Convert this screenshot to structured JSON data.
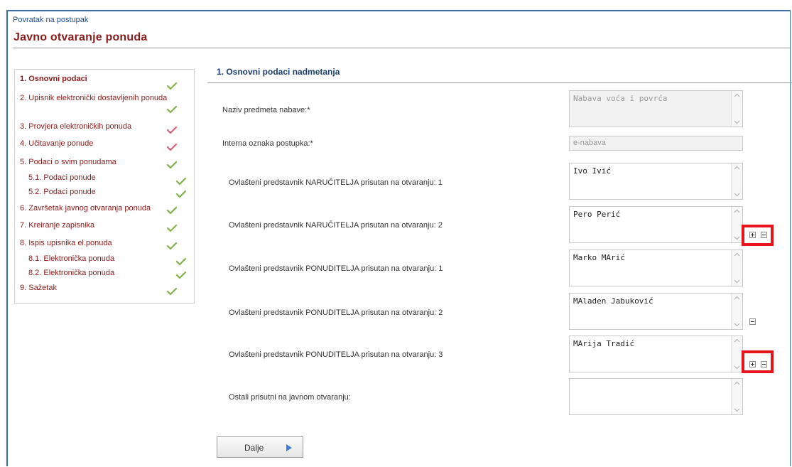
{
  "header": {
    "back_link": "Povratak na postupak",
    "title": "Javno otvaranje ponuda"
  },
  "sidebar": {
    "items": [
      {
        "label": "1. Osnovni podaci",
        "active": true,
        "check": "green"
      },
      {
        "label": "2. Upisnik elektronički dostavljenih ponuda",
        "check": "green"
      },
      {
        "label": "3. Provjera elektroničkih ponuda",
        "check": "red"
      },
      {
        "label": "4. Učitavanje ponude",
        "check": "red"
      },
      {
        "label": "5. Podaci o svim ponudama",
        "check": "green"
      },
      {
        "label": "5.1. Podaci ponude",
        "check": "green"
      },
      {
        "label": "5.2. Podaci ponude",
        "check": "green"
      },
      {
        "label": "6. Završetak javnog otvaranja ponuda",
        "check": "green"
      },
      {
        "label": "7. Kreiranje zapisnika",
        "check": "green"
      },
      {
        "label": "8. Ispis upisnika el.ponuda",
        "check": "green"
      },
      {
        "label": "8.1. Elektronička ponuda",
        "check": "green"
      },
      {
        "label": "8.2. Elektronička ponuda",
        "check": "green"
      },
      {
        "label": "9. Sažetak",
        "check": "green"
      }
    ]
  },
  "main": {
    "section_title": "1. Osnovni podaci nadmetanja",
    "fields": [
      {
        "label": "Naziv predmeta nabave:*",
        "value": "Nabava voća i povrća"
      },
      {
        "label": "Interna oznaka postupka:*",
        "value": "e-nabava"
      },
      {
        "label": "Ovlašteni predstavnik NARUČITELJA prisutan na otvaranju: 1",
        "value": "Ivo Ivić"
      },
      {
        "label": "Ovlašteni predstavnik NARUČITELJA prisutan na otvaranju: 2",
        "value": "Pero Perić"
      },
      {
        "label": "Ovlašteni predstavnik PONUDITELJA prisutan na otvaranju: 1",
        "value": "Marko MArić"
      },
      {
        "label": "Ovlašteni predstavnik PONUDITELJA prisutan na otvaranju: 2",
        "value": "MAladen Jabuković"
      },
      {
        "label": "Ovlašteni predstavnik PONUDITELJA prisutan na otvaranju: 3",
        "value": "MArija Tradić"
      },
      {
        "label": "Ostali prisutni na javnom otvaranju:",
        "value": ""
      }
    ],
    "next_button": "Dalje"
  },
  "colors": {
    "accent_red": "#8b1a1a",
    "link_blue": "#1a4d8f",
    "highlight": "#e8141b",
    "check_green": "#7fb24a",
    "check_red": "#d9607a"
  }
}
